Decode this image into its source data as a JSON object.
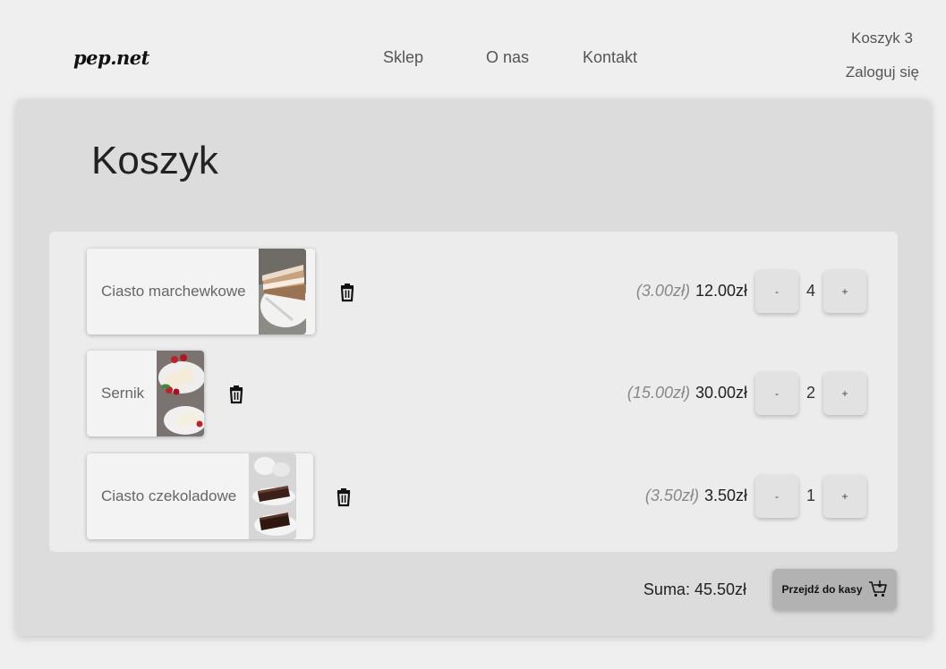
{
  "header": {
    "logo": "pep.net",
    "nav": [
      "Sklep",
      "O nas",
      "Kontakt"
    ],
    "cart_link": "Koszyk 3",
    "login_link": "Zaloguj się"
  },
  "page_title": "Koszyk",
  "items": [
    {
      "name": "Ciasto marchewkowe",
      "unit_price": "(3.00zł)",
      "line_total": "12.00zł",
      "quantity": "4",
      "image": "carrot-cake-photo"
    },
    {
      "name": "Sernik",
      "unit_price": "(15.00zł)",
      "line_total": "30.00zł",
      "quantity": "2",
      "image": "cheesecake-photo"
    },
    {
      "name": "Ciasto czekoladowe",
      "unit_price": "(3.50zł)",
      "line_total": "3.50zł",
      "quantity": "1",
      "image": "chocolate-cake-photo"
    }
  ],
  "buttons": {
    "minus": "-",
    "plus": "+"
  },
  "total": "Suma: 45.50zł",
  "checkout_label": "Przejdź do kasy",
  "icons": {
    "delete": "trash-icon",
    "checkout": "cart-icon"
  }
}
